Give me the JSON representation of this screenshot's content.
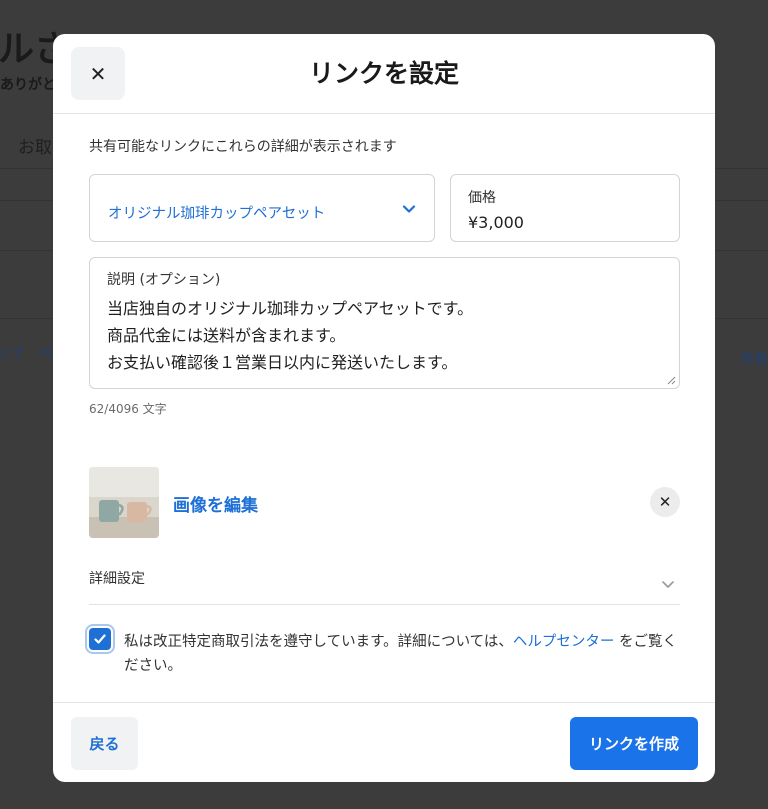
{
  "background": {
    "title_fragment": "ルさ",
    "subtitle_fragment": "ありがと",
    "tab_fragment": "お取",
    "left_link_fragment": "ップ　ペ",
    "right_link_fragment": "共有"
  },
  "modal": {
    "title": "リンクを設定",
    "intro": "共有可能なリンクにこれらの詳細が表示されます",
    "product_select": {
      "value": "オリジナル珈琲カップペアセット"
    },
    "price": {
      "label": "価格",
      "value": "¥3,000"
    },
    "description": {
      "label": "説明 (オプション)",
      "lines": [
        "当店独自のオリジナル珈琲カップペアセットです。",
        "商品代金には送料が含まれます。",
        "お支払い確認後１営業日以内に発送いたします。"
      ],
      "char_count": "62/4096 文字"
    },
    "image": {
      "edit_label": "画像を編集"
    },
    "advanced_settings": {
      "label": "詳細設定"
    },
    "legal": {
      "checked": true,
      "text_before": "私は改正特定商取引法を遵守しています。詳細については、",
      "link": "ヘルプセンター",
      "text_after": " をご覧ください。"
    },
    "footer": {
      "back_label": "戻る",
      "create_label": "リンクを作成"
    }
  },
  "icons": {
    "close": "close-icon",
    "chevron": "chevron-down-icon",
    "check": "check-icon",
    "remove": "close-icon"
  },
  "colors": {
    "accent": "#1a73e8",
    "link": "#1e6fd6",
    "overlay": "#3c3c3c"
  }
}
